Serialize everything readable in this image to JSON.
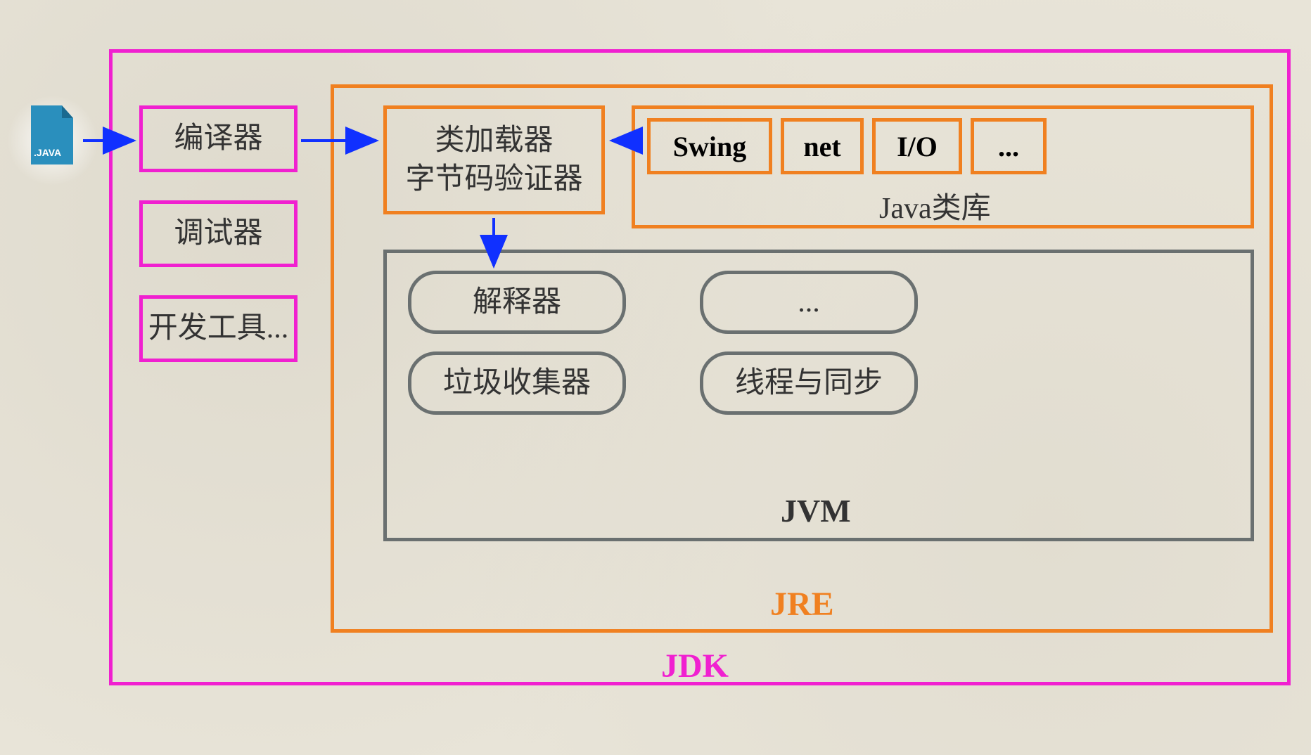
{
  "file_icon_label": ".JAVA",
  "jdk": {
    "label": "JDK"
  },
  "left_tools": {
    "compiler": "编译器",
    "debugger": "调试器",
    "devtools": "开发工具..."
  },
  "jre": {
    "label": "JRE",
    "classloader_line1": "类加载器",
    "classloader_line2": "字节码验证器",
    "libraries": {
      "label": "Java类库",
      "items": [
        "Swing",
        "net",
        "I/O",
        "..."
      ]
    },
    "jvm": {
      "label": "JVM",
      "boxes": {
        "interpreter": "解释器",
        "more": "...",
        "gc": "垃圾收集器",
        "threads": "线程与同步"
      }
    }
  },
  "colors": {
    "magenta": "#f020d0",
    "orange": "#f08020",
    "gray": "#6a7070",
    "arrow": "#1030ff"
  }
}
